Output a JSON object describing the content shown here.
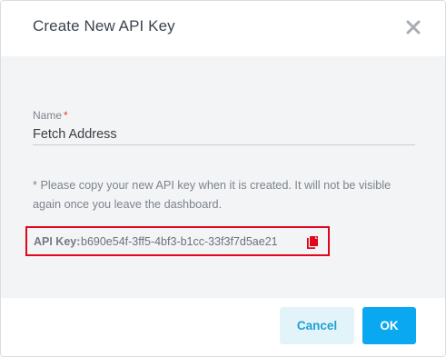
{
  "dialog": {
    "title": "Create New API Key"
  },
  "form": {
    "name_label": "Name",
    "required_mark": "*",
    "name_value": "Fetch Address",
    "notice": "* Please copy your new API key when it is created. It will not be visible again once you leave the dashboard."
  },
  "api_key": {
    "label": "API Key:",
    "value": "b690e54f-3ff5-4bf3-b1cc-33f3f7d5ae21"
  },
  "footer": {
    "cancel_label": "Cancel",
    "ok_label": "OK"
  },
  "icons": {
    "close": "close-icon",
    "copy": "copy-icon"
  },
  "colors": {
    "accent": "#0aa8f0",
    "cancel_bg": "#e2f4f9",
    "highlight_border": "#e0061c",
    "copy_icon": "#e0061c",
    "required": "#e53935"
  }
}
